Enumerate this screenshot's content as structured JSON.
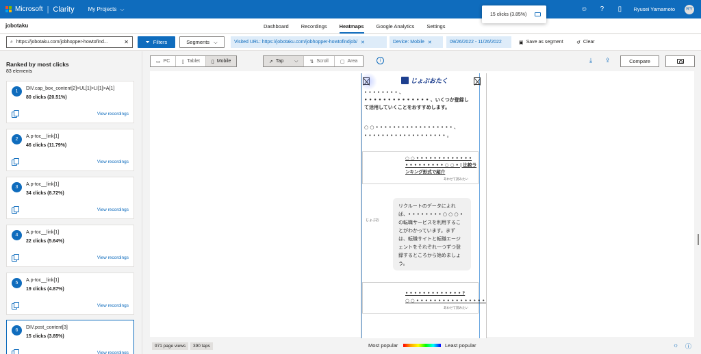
{
  "app": {
    "brand": "Microsoft",
    "product": "Clarity",
    "projects_label": "My Projects"
  },
  "top_right": {
    "user": "Ryusei Yamamoto",
    "avatar_initials": "RY"
  },
  "nav": {
    "project_name": "jobotaku",
    "tabs": [
      {
        "label": "Dashboard",
        "active": false
      },
      {
        "label": "Recordings",
        "active": false
      },
      {
        "label": "Heatmaps",
        "active": true
      },
      {
        "label": "Google Analytics",
        "active": false
      },
      {
        "label": "Settings",
        "active": false
      }
    ]
  },
  "popup": {
    "text": "15 clicks (3.85%)"
  },
  "filters": {
    "search_value": "https://jobotaku.com/jobhopper-howtofind...",
    "filters_label": "Filters",
    "segments_label": "Segments",
    "chips": [
      "Visited URL: https://jobotaku.com/jobhopper-howtofindjob/",
      "Device: Mobile",
      "09/26/2022 - 11/26/2022"
    ],
    "save_segment_label": "Save as segment",
    "clear_label": "Clear"
  },
  "left": {
    "title": "Ranked by most clicks",
    "subtitle": "83 elements",
    "view_label": "View recordings",
    "items": [
      {
        "rank": "1",
        "element": "DIV.cap_box_content[2]>UL[1]>LI[1]>A[1]",
        "clicks": "80 clicks (20.51%)"
      },
      {
        "rank": "2",
        "element": "A.p-toc__link[1]",
        "clicks": "46 clicks (11.79%)"
      },
      {
        "rank": "3",
        "element": "A.p-toc__link[1]",
        "clicks": "34 clicks (8.72%)"
      },
      {
        "rank": "4",
        "element": "A.p-toc__link[1]",
        "clicks": "22 clicks (5.64%)"
      },
      {
        "rank": "5",
        "element": "A.p-toc__link[1]",
        "clicks": "19 clicks (4.87%)"
      },
      {
        "rank": "6",
        "element": "DIV.post_content[3]",
        "clicks": "15 clicks (3.85%)"
      }
    ]
  },
  "toolbar": {
    "devices": [
      "PC",
      "Tablet",
      "Mobile"
    ],
    "modes": [
      "Tap",
      "Scroll",
      "Area"
    ],
    "compare_label": "Compare"
  },
  "preview": {
    "logo_text": "じょぶおたく",
    "para1_line1": "• • • • • • • • 、",
    "para1_line2": "• • • • • • • • • • • • • • 、いくつか登録し",
    "para1_line3": "て活用していくことをおすすめします。",
    "para2_line1": "○ ○ • • • • • • • • • • • • • • • • • • 、",
    "para2_line2": "• • • • • • • • • • • • • • • • • • • 。",
    "link1_line1": "○ ○ • • • • • • • • • • • • •",
    "link1_line2": "• • • • • • • • • ○ ○ • | 比較ラ",
    "link1_line3": "ンキング形式で紹介",
    "note": "あわせて読みたい",
    "bubble_name": "じょぶお",
    "bubble_lines": [
      "リクルートのデータによれ",
      "ば、• • • • • • • • ○ ○ ○ •",
      "の転職サービスを利用するこ",
      "とがわかっています。まず",
      "は、転職サイトと転職エージ",
      "ェントをそれぞれ一つずつ登",
      "録するところから始めましょ",
      "う。"
    ],
    "link2_line1": "• • • • • • • • • • • • • ?",
    "link2_line2": "○ ○ • • • • • • • • • • • • • • • • • •"
  },
  "footer": {
    "page_views": "971 page views",
    "taps": "390 taps",
    "most_popular": "Most popular",
    "least_popular": "Least popular"
  }
}
